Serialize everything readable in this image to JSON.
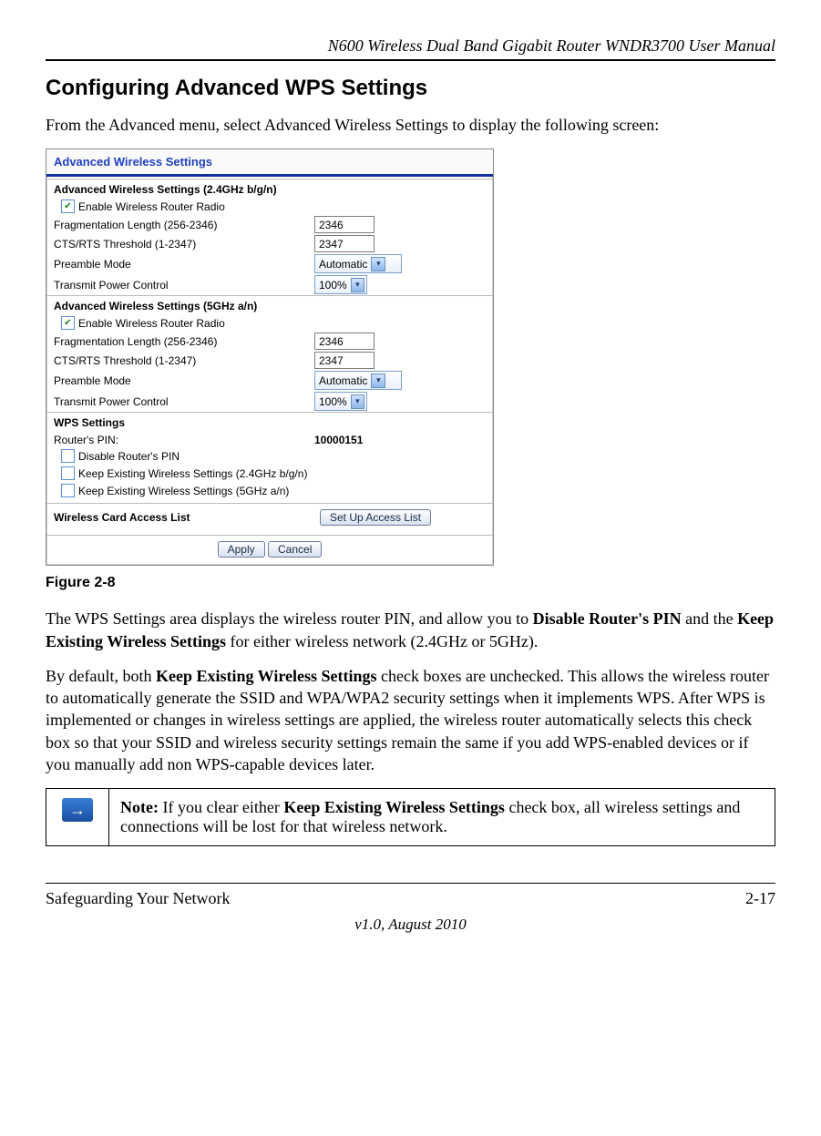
{
  "header": {
    "manual_title": "N600 Wireless Dual Band Gigabit Router WNDR3700 User Manual"
  },
  "section": {
    "heading": "Configuring Advanced WPS Settings",
    "intro": "From the Advanced menu, select Advanced Wireless Settings to display the following screen:"
  },
  "panel": {
    "title": "Advanced Wireless Settings",
    "band24": {
      "heading": "Advanced Wireless Settings (2.4GHz b/g/n)",
      "enable_label": "Enable Wireless Router Radio",
      "enable_checked": true,
      "frag_label": "Fragmentation Length (256-2346)",
      "frag_value": "2346",
      "cts_label": "CTS/RTS Threshold (1-2347)",
      "cts_value": "2347",
      "preamble_label": "Preamble Mode",
      "preamble_value": "Automatic",
      "txpower_label": "Transmit Power Control",
      "txpower_value": "100%"
    },
    "band5": {
      "heading": "Advanced Wireless Settings (5GHz a/n)",
      "enable_label": "Enable Wireless Router Radio",
      "enable_checked": true,
      "frag_label": "Fragmentation Length (256-2346)",
      "frag_value": "2346",
      "cts_label": "CTS/RTS Threshold (1-2347)",
      "cts_value": "2347",
      "preamble_label": "Preamble Mode",
      "preamble_value": "Automatic",
      "txpower_label": "Transmit Power Control",
      "txpower_value": "100%"
    },
    "wps": {
      "heading": "WPS Settings",
      "pin_label": "Router's PIN:",
      "pin_value": "10000151",
      "disable_pin_label": "Disable Router's PIN",
      "keep24_label": "Keep Existing Wireless Settings (2.4GHz b/g/n)",
      "keep5_label": "Keep Existing Wireless Settings (5GHz a/n)"
    },
    "acl": {
      "label": "Wireless Card Access List",
      "button": "Set Up Access List"
    },
    "buttons": {
      "apply": "Apply",
      "cancel": "Cancel"
    }
  },
  "figure": {
    "caption": "Figure 2-8"
  },
  "paragraphs": {
    "p1a": "The WPS Settings area displays the wireless router PIN, and allow you to ",
    "p1b": "Disable Router's PIN",
    "p1c": " and the ",
    "p1d": "Keep Existing Wireless Settings",
    "p1e": " for either wireless network (2.4GHz or 5GHz).",
    "p2a": "By default, both ",
    "p2b": "Keep Existing Wireless Settings",
    "p2c": " check boxes are unchecked. This allows the wireless router to automatically generate the SSID and WPA/WPA2 security settings when it implements WPS. After WPS is implemented or changes in wireless settings are applied, the wireless router automatically selects this check box so that your SSID and wireless security settings remain the same if you add WPS-enabled devices or if you manually add non WPS-capable devices later."
  },
  "note": {
    "prefix": "Note:",
    "text_a": " If you clear either ",
    "text_b": "Keep Existing Wireless Settings",
    "text_c": " check box, all wireless settings and connections will be lost for that wireless network."
  },
  "footer": {
    "left": "Safeguarding Your Network",
    "right": "2-17",
    "center": "v1.0, August 2010"
  }
}
